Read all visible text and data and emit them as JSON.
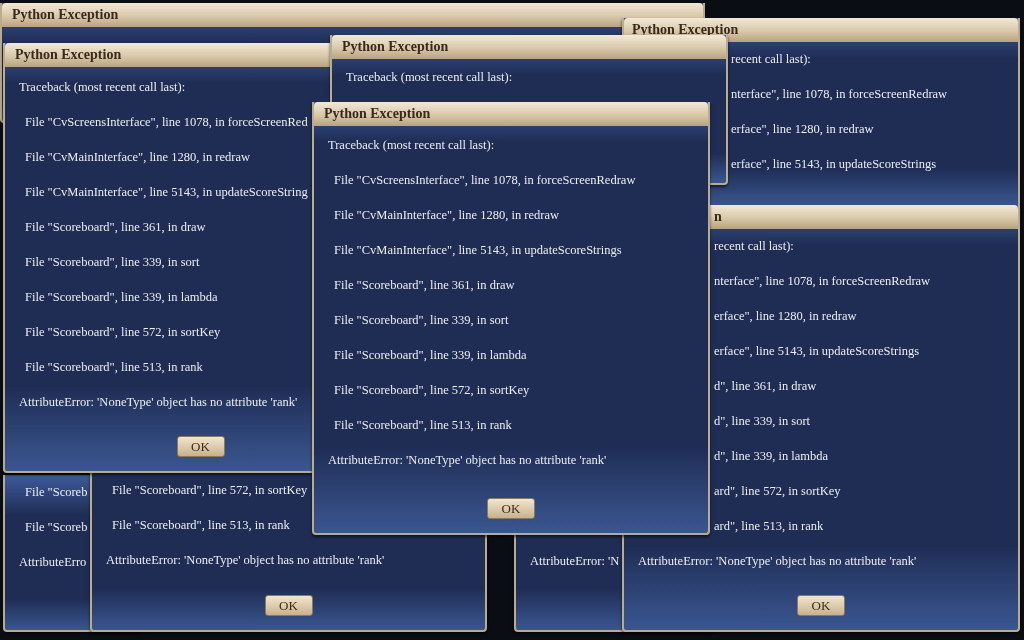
{
  "windows": [
    {
      "title": {
        "kind": "full",
        "text": "Python Exception"
      }
    },
    {
      "lines": [
        {
          "kind": "frame",
          "text": "File \"Scoreb"
        },
        {
          "kind": "frame",
          "text": "File \"Scoreb"
        },
        {
          "kind": "heading",
          "text": "AttributeErro"
        }
      ]
    },
    {
      "lines": [
        {
          "kind": "heading",
          "text": "AttributeError: 'N"
        }
      ]
    },
    {
      "lines": [
        {
          "kind": "frame",
          "text": "File \"Scoreboard\", line 572, in sortKey"
        },
        {
          "kind": "frame",
          "text": "File \"Scoreboard\", line 513, in rank"
        },
        {
          "kind": "heading",
          "text": "AttributeError: 'NoneType' object has no attribute 'rank'"
        }
      ],
      "ok_button": "OK"
    },
    {
      "title": {
        "kind": "full",
        "text": "Python Exception"
      },
      "lines": [
        {
          "kind": "heading",
          "text": "Traceback (most recent call last):"
        },
        {
          "kind": "frame",
          "text": "File \"CvScreensInterface\", line 1078, in forceScreenRed"
        },
        {
          "kind": "frame",
          "text": "File \"CvMainInterface\", line 1280, in redraw"
        },
        {
          "kind": "frame",
          "text": "File \"CvMainInterface\", line 5143, in updateScoreString"
        },
        {
          "kind": "frame",
          "text": "File \"Scoreboard\", line 361, in draw"
        },
        {
          "kind": "frame",
          "text": "File \"Scoreboard\", line 339, in sort"
        },
        {
          "kind": "frame",
          "text": "File \"Scoreboard\", line 339, in lambda"
        },
        {
          "kind": "frame",
          "text": "File \"Scoreboard\", line 572, in sortKey"
        },
        {
          "kind": "frame",
          "text": "File \"Scoreboard\", line 513, in rank"
        },
        {
          "kind": "heading",
          "text": "AttributeError: 'NoneType' object has no attribute 'rank'"
        }
      ],
      "ok_button": "OK"
    },
    {
      "title": {
        "kind": "full",
        "text": "Python Exception"
      },
      "lines": [
        {
          "kind": "cut",
          "text": "recent call last):"
        },
        {
          "kind": "cut",
          "text": "nterface\", line 1078, in forceScreenRedraw"
        },
        {
          "kind": "cut",
          "text": "erface\", line 1280, in redraw"
        },
        {
          "kind": "cut",
          "text": "erface\", line 5143, in updateScoreStrings"
        }
      ]
    },
    {
      "title": {
        "kind": "cut",
        "text": "n"
      },
      "lines": [
        {
          "kind": "cut",
          "text": "recent call last):"
        },
        {
          "kind": "cut",
          "text": "nterface\", line 1078, in forceScreenRedraw"
        },
        {
          "kind": "cut",
          "text": "erface\", line 1280, in redraw"
        },
        {
          "kind": "cut",
          "text": "erface\", line 5143, in updateScoreStrings"
        },
        {
          "kind": "cut",
          "text": "d\", line 361, in draw"
        },
        {
          "kind": "cut",
          "text": "d\", line 339, in sort"
        },
        {
          "kind": "cut",
          "text": "d\", line 339, in lambda"
        },
        {
          "kind": "cut",
          "text": "ard\", line 572, in sortKey"
        },
        {
          "kind": "cut",
          "text": "ard\", line 513, in rank"
        },
        {
          "kind": "heading",
          "text": "AttributeError: 'NoneType' object has no attribute 'rank'"
        }
      ],
      "ok_button": "OK"
    },
    {
      "title": {
        "kind": "full",
        "text": "Python Exception"
      },
      "lines": [
        {
          "kind": "heading",
          "text": "Traceback (most recent call last):"
        }
      ]
    },
    {
      "title": {
        "kind": "full",
        "text": "Python Exception"
      },
      "lines": [
        {
          "kind": "heading",
          "text": "Traceback (most recent call last):"
        },
        {
          "kind": "frame",
          "text": "File \"CvScreensInterface\", line 1078, in forceScreenRedraw"
        },
        {
          "kind": "frame",
          "text": "File \"CvMainInterface\", line 1280, in redraw"
        },
        {
          "kind": "frame",
          "text": "File \"CvMainInterface\", line 5143, in updateScoreStrings"
        },
        {
          "kind": "frame",
          "text": "File \"Scoreboard\", line 361, in draw"
        },
        {
          "kind": "frame",
          "text": "File \"Scoreboard\", line 339, in sort"
        },
        {
          "kind": "frame",
          "text": "File \"Scoreboard\", line 339, in lambda"
        },
        {
          "kind": "frame",
          "text": "File \"Scoreboard\", line 572, in sortKey"
        },
        {
          "kind": "frame",
          "text": "File \"Scoreboard\", line 513, in rank"
        },
        {
          "kind": "heading",
          "text": "AttributeError: 'NoneType' object has no attribute 'rank'"
        }
      ],
      "ok_button": "OK"
    }
  ]
}
